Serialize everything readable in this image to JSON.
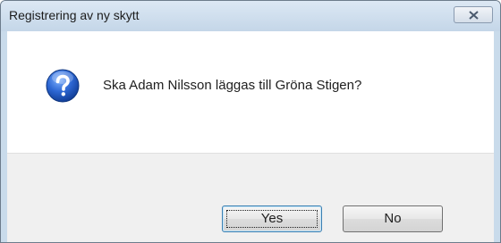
{
  "window": {
    "title": "Registrering av ny skytt",
    "close_icon": "close-icon"
  },
  "dialog": {
    "icon": "question-icon",
    "message": "Ska Adam Nilsson läggas till Gröna Stigen?"
  },
  "buttons": {
    "yes_label": "Yes",
    "no_label": "No"
  },
  "colors": {
    "accent": "#1f5fbf",
    "frame": "#c9dbeb"
  }
}
